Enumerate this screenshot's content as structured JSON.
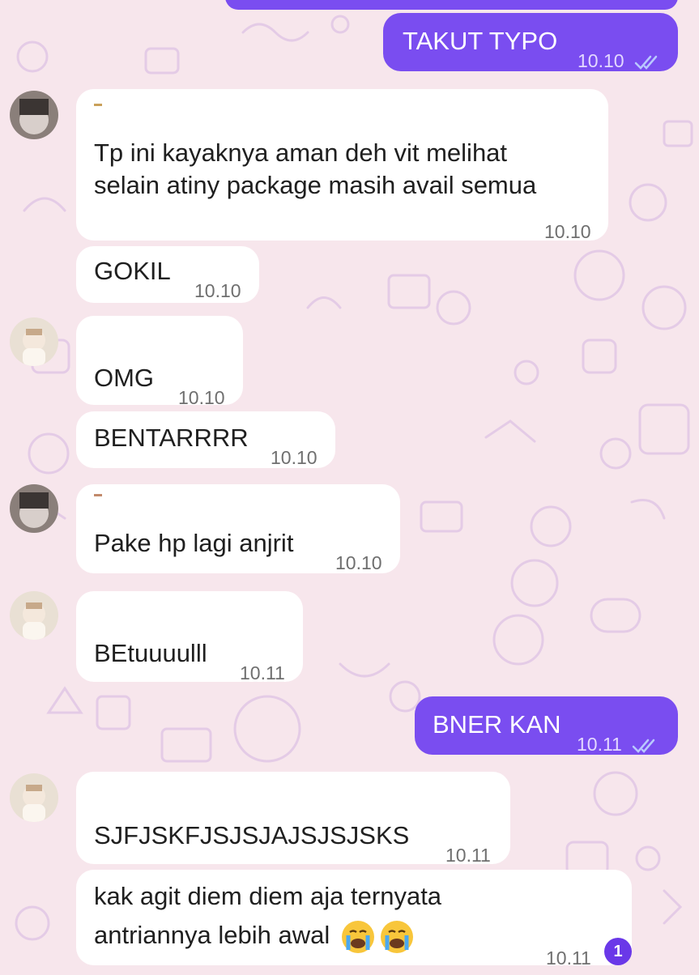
{
  "colors": {
    "outgoing_bubble": "#7a4df0",
    "incoming_bubble": "#ffffff",
    "wallpaper": "#f7e6ec",
    "read_ticks": "#b9c8ff",
    "unread_badge": "#6a38e8"
  },
  "messages": [
    {
      "text": "TAKUT TYPO",
      "time": "10.10",
      "read": "double-check-icon"
    },
    {
      "lines": [
        "Tp ini kayaknya aman deh vit melihat",
        "selain atiny package masih avail semua"
      ],
      "time": "10.10"
    },
    {
      "text": "GOKIL",
      "time": "10.10"
    },
    {
      "text": "OMG",
      "time": "10.10"
    },
    {
      "text": "BENTARRRR",
      "time": "10.10"
    },
    {
      "text": "Pake hp lagi anjrit",
      "time": "10.10"
    },
    {
      "text": "BEtuuuulll",
      "time": "10.11"
    },
    {
      "text": "BNER KAN",
      "time": "10.11",
      "read": "double-check-icon"
    },
    {
      "text": "SJFJSKFJSJSJAJSJSJSKS",
      "time": "10.11"
    },
    {
      "lines": [
        "kak agit diem diem aja ternyata",
        "antriannya lebih awal"
      ],
      "emojis": [
        "crying-face-icon",
        "crying-face-icon"
      ],
      "time": "10.11"
    }
  ],
  "unread_badge": {
    "count": "1"
  }
}
